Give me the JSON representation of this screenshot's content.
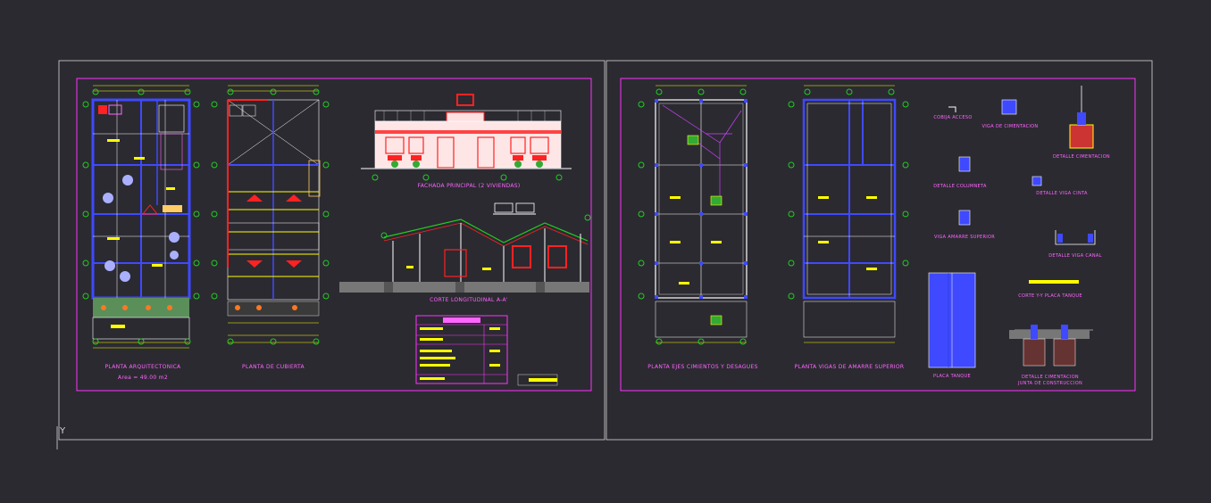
{
  "colors": {
    "background": "#2b2a31",
    "sheet_frame": "#d8d8d8",
    "title_frame": "#ff33ff",
    "walls": "#3f49ff",
    "dims": "#ffff00",
    "marks": "#ff2222",
    "grid_axis": "#22cc22",
    "text": "#ff66ff"
  },
  "sheet_left": {
    "title_planta_arq": "PLANTA ARQUITECTONICA",
    "area_text": "Area = 49.00 m2",
    "title_planta_cubierta": "PLANTA DE CUBIERTA",
    "title_fachada": "FACHADA PRINCIPAL (2 VIVIENDAS)",
    "title_corte": "CORTE LONGITUDINAL A-A'"
  },
  "sheet_right": {
    "title_cimientos": "PLANTA EJES CIMIENTOS Y DESAGUES",
    "title_vigas": "PLANTA VIGAS DE AMARRE SUPERIOR",
    "detail_cobija": "COBIJA ACCESO",
    "detail_viga_cimentacion": "VIGA DE CIMENTACION",
    "detail_cimentacion": "DETALLE CIMENTACION",
    "detail_columneta": "DETALLE COLUMNETA",
    "detail_viga_cinta": "DETALLE VIGA CINTA",
    "detail_viga_amarre": "VIGA AMARRE SUPERIOR",
    "detail_viga_canal": "DETALLE VIGA CANAL",
    "detail_corte_tanque": "CORTE Y-Y PLACA TANQUE",
    "detail_placa_tanque": "PLACA TANQUE",
    "detail_junta_1": "DETALLE CIMENTACION",
    "detail_junta_2": "JUNTA DE CONSTRUCCION"
  },
  "ucs_icon": "ucs-axis-icon",
  "ucs_label": "Y"
}
